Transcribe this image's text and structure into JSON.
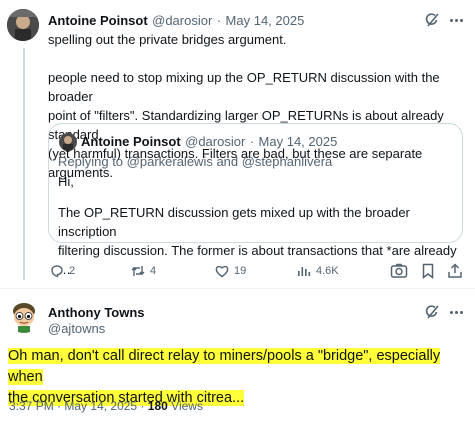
{
  "main_tweet": {
    "author_name": "Antoine Poinsot",
    "handle": "@darosior",
    "sep": "·",
    "date": "May 14, 2025",
    "line1": "spelling out the private bridges argument.",
    "line2": "people need to stop mixing up the OP_RETURN discussion with the broader",
    "line3": "point of \"filters\". Standardizing larger OP_RETURNs is about already standard",
    "line4": "(yet harmful) transactions. Filters are bad, but these are separate arguments."
  },
  "quote": {
    "author_name": "Antoine Poinsot",
    "handle": "@darosior",
    "sep": "·",
    "date": "May 14, 2025",
    "replying_to_prefix": "Replying to ",
    "replying_to_users": "@parkeralewis and @stephanlivera",
    "line1": "Hi,",
    "line2": "The OP_RETURN discussion gets mixed up with the broader inscription",
    "line3": "filtering discussion. The former is about transactions that *are already …"
  },
  "actions": {
    "replies": "2",
    "reposts": "4",
    "likes": "19",
    "views": "4.6K"
  },
  "reply_tweet": {
    "author_name": "Anthony Towns",
    "handle": "@ajtowns",
    "line1": "Oh man, don't call direct relay to miners/pools a \"bridge\", especially when",
    "line2": "the conversation started with citrea...",
    "time": "3:37 PM",
    "sep": "·",
    "date": "May 14, 2025",
    "sep2": "·",
    "views_count": "180",
    "views_label": "Views",
    "highlight_color": "#ffff3a"
  },
  "icons": {
    "grok": "grok-icon",
    "more": "more-dots-icon",
    "reply": "reply-icon",
    "repost": "repost-icon",
    "like": "like-icon",
    "views": "views-icon",
    "lens": "grok-lens-icon",
    "bookmark": "bookmark-icon",
    "share": "share-icon"
  },
  "colors": {
    "text": "#0f1419",
    "muted": "#536471",
    "border": "#cfd9de"
  }
}
